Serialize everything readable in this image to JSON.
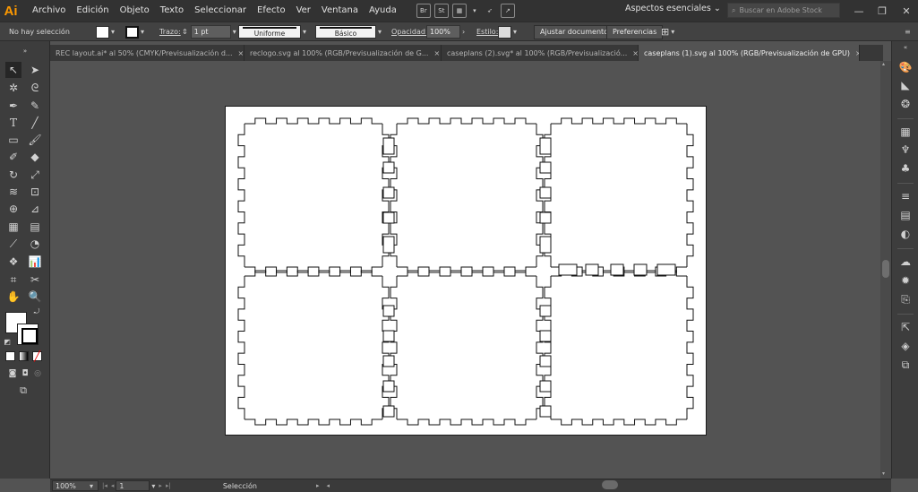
{
  "menubar": {
    "logo": "Ai",
    "items": [
      "Archivo",
      "Edición",
      "Objeto",
      "Texto",
      "Seleccionar",
      "Efecto",
      "Ver",
      "Ventana",
      "Ayuda"
    ],
    "app_icons": [
      "Br",
      "St"
    ],
    "workspace": "Aspectos esenciales",
    "search_placeholder": "Buscar en Adobe Stock"
  },
  "controlbar": {
    "selection": "No hay selección",
    "stroke_label": "Trazo:",
    "stroke_weight": "1 pt",
    "profile": "Uniforme",
    "brush": "Básico",
    "opacity_label": "Opacidad:",
    "opacity_value": "100%",
    "style_label": "Estilo:",
    "doc_setup": "Ajustar documento",
    "preferences": "Preferencias"
  },
  "tabs": [
    {
      "label": "REC layout.ai* al 50% (CMYK/Previsualización d...",
      "active": false
    },
    {
      "label": "reclogo.svg al 100% (RGB/Previsualización de G...",
      "active": false
    },
    {
      "label": "caseplans (2).svg* al 100% (RGB/Previsualizació...",
      "active": false
    },
    {
      "label": "caseplans (1).svg al 100% (RGB/Previsualización de GPU)",
      "active": true
    }
  ],
  "status": {
    "zoom": "100%",
    "artboard": "1",
    "tool": "Selección"
  },
  "colors": {
    "accent_logo": "#ff9a00",
    "ui_dark": "#323232",
    "canvas": "#535353"
  }
}
